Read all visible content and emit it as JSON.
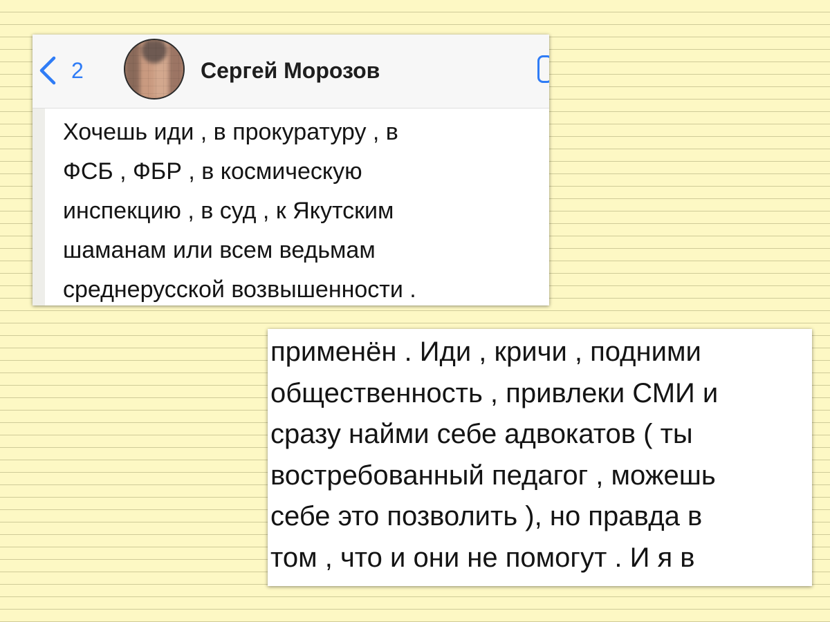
{
  "chat": {
    "back_count": "2",
    "contact_name": "Сергей Морозов",
    "message_lines": [
      "Хочешь иди , в прокуратуру , в",
      "ФСБ , ФБР , в космическую",
      "инспекцию , в суд , к Якутским",
      "шаманам или всем ведьмам",
      "среднерусской возвышенности ."
    ]
  },
  "fragment": {
    "lines": [
      "применён . Иди , кричи , подними",
      "общественность , привлеки СМИ и",
      "сразу найми себе адвокатов ( ты",
      "востребованный педагог , можешь",
      "себе это позволить ), но правда в",
      "том , что и они не помогут . И я в"
    ]
  },
  "icons": {
    "back": "chevron-left-icon",
    "avatar": "blurred-avatar",
    "header_right": "partial-icon"
  },
  "colors": {
    "accent": "#2f7cf6",
    "paper": "#fdf8c4",
    "rule": "#cfcb98"
  }
}
